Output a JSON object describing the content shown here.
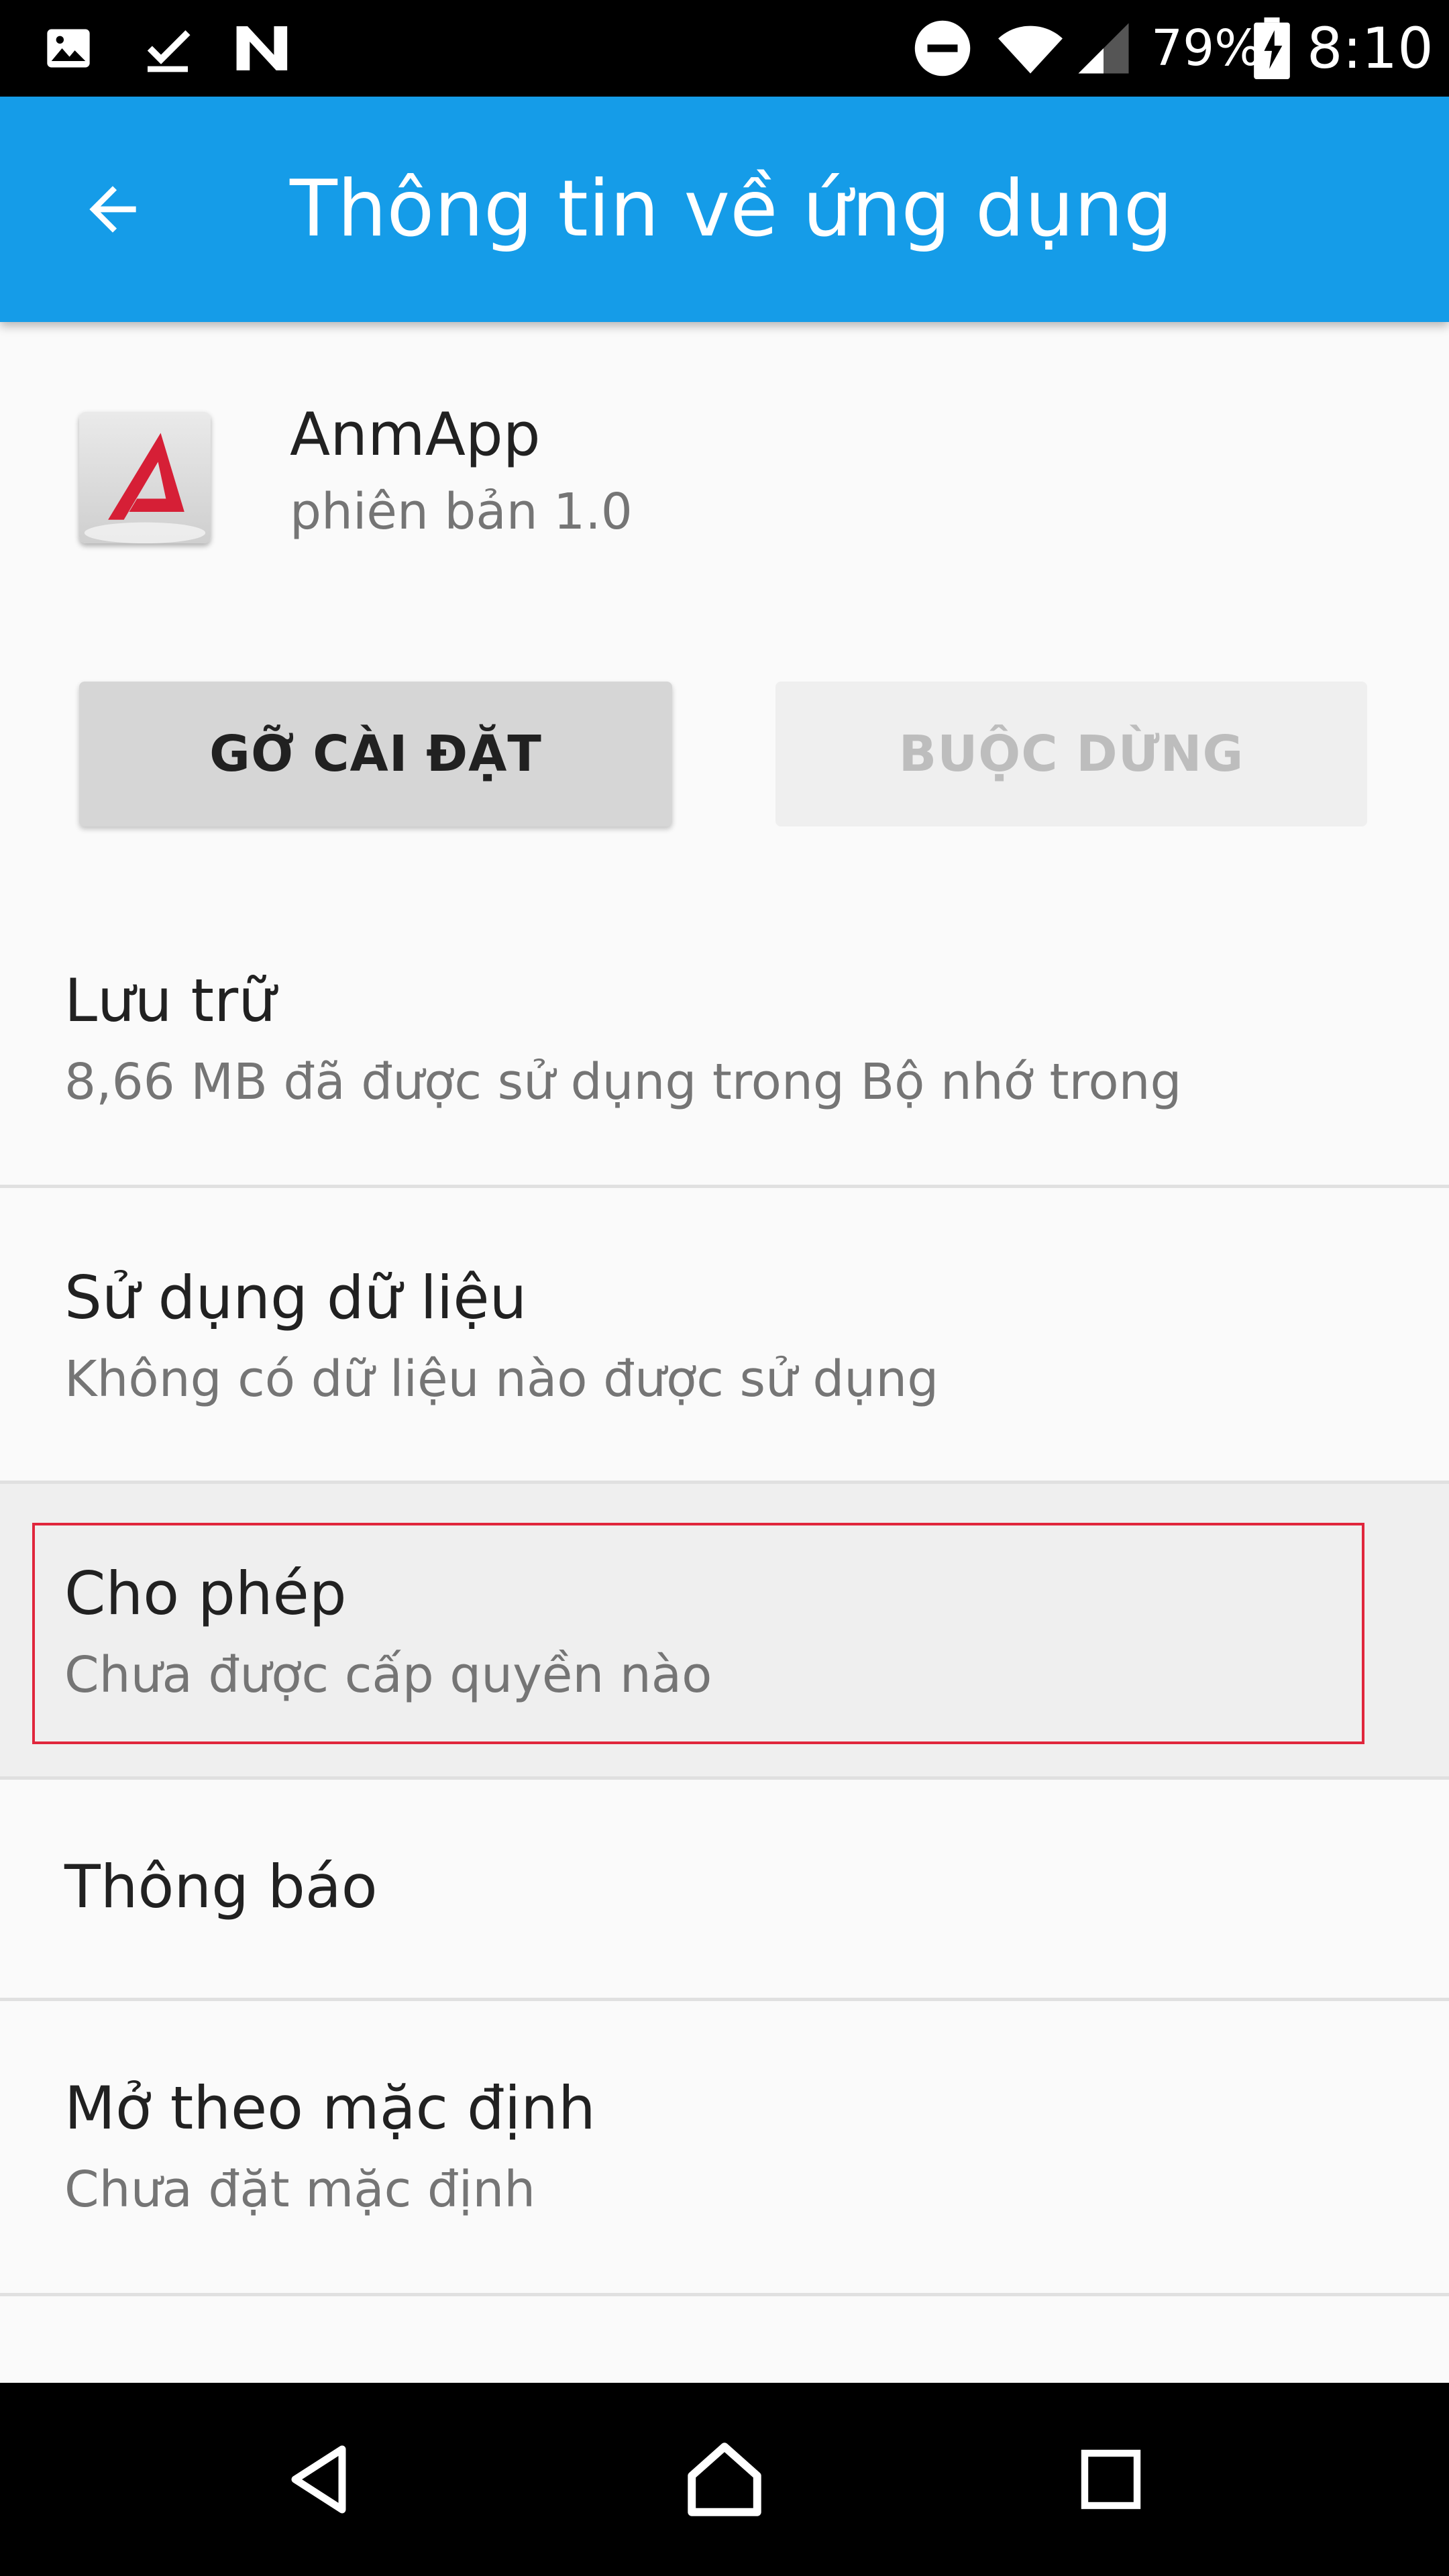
{
  "status_bar": {
    "battery": "79%",
    "time": "8:10",
    "icons": [
      "image-icon",
      "checkmark-icon",
      "n-icon",
      "dnd-icon",
      "wifi-icon",
      "signal-icon",
      "battery-charging-icon"
    ]
  },
  "toolbar": {
    "title": "Thông tin về ứng dụng",
    "back_icon": "arrow-back-icon"
  },
  "app": {
    "name": "AnmApp",
    "version": "phiên bản 1.0"
  },
  "buttons": {
    "uninstall": "GỠ CÀI ĐẶT",
    "force_stop": "BUỘC DỪNG"
  },
  "prefs": [
    {
      "title": "Lưu trữ",
      "summary": "8,66 MB đã được sử dụng trong Bộ nhớ trong"
    },
    {
      "title": "Sử dụng dữ liệu",
      "summary": "Không có dữ liệu nào được sử dụng"
    },
    {
      "title": "Cho phép",
      "summary": "Chưa được cấp quyền nào"
    },
    {
      "title": "Thông báo",
      "summary": ""
    },
    {
      "title": "Mở theo mặc định",
      "summary": "Chưa đặt mặc định"
    }
  ],
  "colors": {
    "app_bar": "#159ce8",
    "highlight": "#e0263c",
    "logo_red": "#d61f36"
  },
  "nav_bar": {
    "icons": [
      "back-icon",
      "home-icon",
      "recents-icon"
    ]
  }
}
